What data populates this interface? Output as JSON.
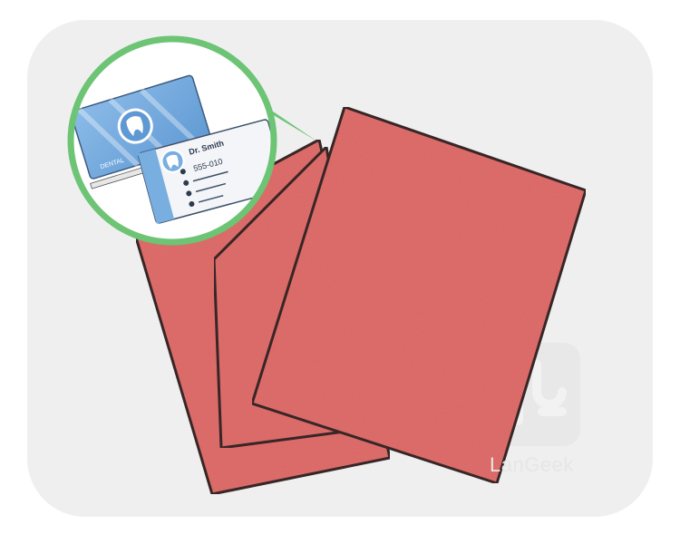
{
  "illustration": {
    "subject": "stack of red paper sheets with an inset showing dental business cards",
    "colors": {
      "background": "#efefef",
      "paper": "#e06e6c",
      "paper_edge": "#3a2c2c",
      "inset_ring": "#6cc474",
      "card_blue": "#78aee0",
      "card_white": "#f3f5f8"
    },
    "icons": [
      "tooth-icon",
      "phone-icon",
      "location-icon",
      "email-icon",
      "web-icon"
    ]
  },
  "card": {
    "name_text": "Dr. Smith",
    "phone_text": "555-010",
    "back_text": "DENTAL"
  },
  "watermark": {
    "brand": "LanGeek"
  }
}
